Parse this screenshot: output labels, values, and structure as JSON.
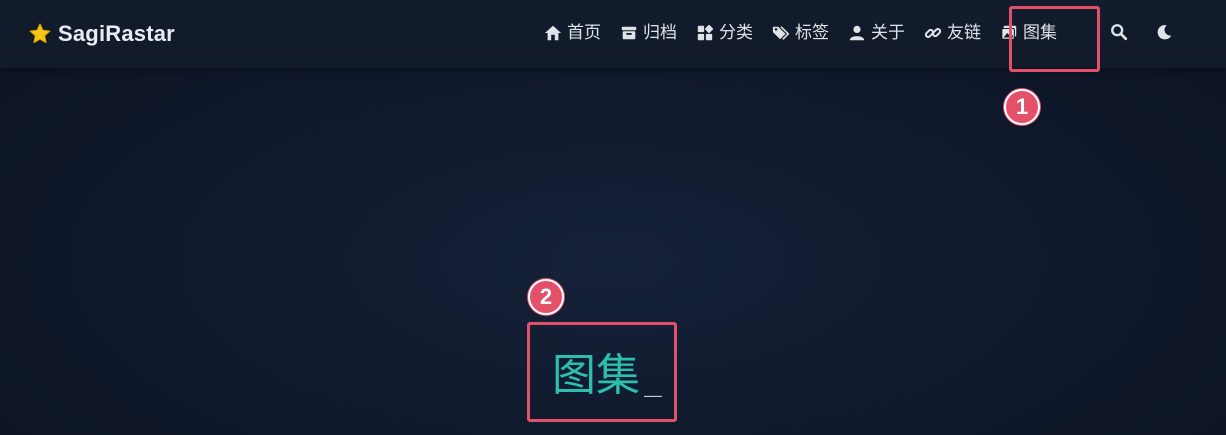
{
  "brand": {
    "name": "SagiRastar",
    "icon": "star-icon",
    "icon_color": "#f5c518"
  },
  "nav": {
    "items": [
      {
        "label": "首页",
        "icon": "home-icon"
      },
      {
        "label": "归档",
        "icon": "archive-icon"
      },
      {
        "label": "分类",
        "icon": "categories-icon"
      },
      {
        "label": "标签",
        "icon": "tags-icon"
      },
      {
        "label": "关于",
        "icon": "user-icon"
      },
      {
        "label": "友链",
        "icon": "link-icon"
      },
      {
        "label": "图集",
        "icon": "gallery-icon"
      }
    ],
    "search_icon": "search-icon",
    "theme_icon": "moon-icon"
  },
  "hero": {
    "title": "图集",
    "cursor": "_",
    "title_color": "#2bbfae"
  },
  "annotations": {
    "callout_1": "1",
    "callout_2": "2",
    "color": "#e4506a"
  }
}
